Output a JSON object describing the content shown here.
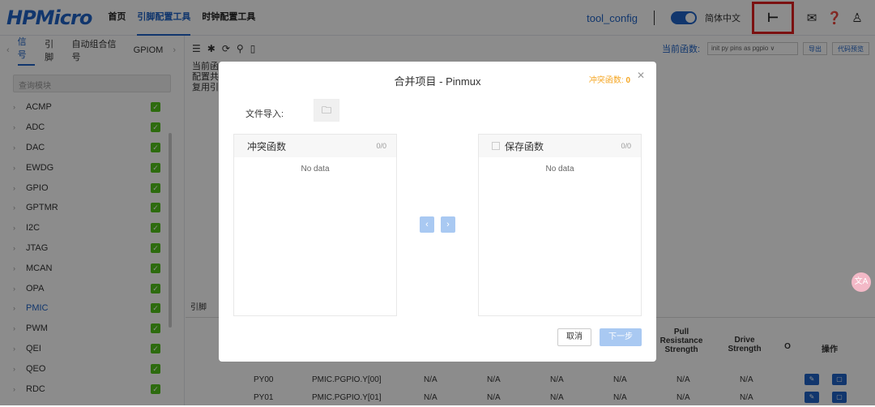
{
  "header": {
    "logo": "HPMicro",
    "nav": [
      "首页",
      "引脚配置工具",
      "时钟配置工具"
    ],
    "active_nav": 1,
    "project": "tool_config",
    "language": "简体中文"
  },
  "left": {
    "tabs": [
      "信号",
      "引脚",
      "自动组合信号",
      "GPIOM"
    ],
    "search_placeholder": "查询模块",
    "modules": [
      "ACMP",
      "ADC",
      "DAC",
      "EWDG",
      "GPIO",
      "GPTMR",
      "I2C",
      "JTAG",
      "MCAN",
      "OPA",
      "PMIC",
      "PWM",
      "QEI",
      "QEO",
      "RDC"
    ],
    "active_module": "PMIC"
  },
  "main": {
    "current_func_label": "当前函数:",
    "current_func_value": "init py pins as pgpio ∨",
    "export_label": "导出",
    "preview_label": "代码预览",
    "info_lines": [
      "当前函",
      "配置共",
      "复用引"
    ],
    "lower_tab": "引脚",
    "table_headers": {
      "pull": "Pull Resistance Strength",
      "drive": "Drive Strength",
      "op": "操作",
      "o": "O"
    },
    "rows": [
      {
        "pin": "PY00",
        "func": "PMIC.PGPIO.Y[00]",
        "v1": "N/A",
        "v2": "N/A",
        "v3": "N/A",
        "v4": "N/A",
        "v5": "N/A",
        "v6": "N/A"
      },
      {
        "pin": "PY01",
        "func": "PMIC.PGPIO.Y[01]",
        "v1": "N/A",
        "v2": "N/A",
        "v3": "N/A",
        "v4": "N/A",
        "v5": "N/A",
        "v6": "N/A"
      }
    ]
  },
  "dialog": {
    "title": "合并项目 - Pinmux",
    "conflict_label": "冲突函数:",
    "conflict_count": "0",
    "file_import_label": "文件导入:",
    "left_panel_title": "冲突函数",
    "left_panel_count": "0/0",
    "right_panel_title": "保存函数",
    "right_panel_count": "0/0",
    "no_data": "No data",
    "cancel_label": "取消",
    "next_label": "下一步"
  },
  "icons": {
    "merge": "branch-icon",
    "mail": "mail-icon",
    "help": "help-icon",
    "user": "user-icon",
    "folder": "folder-icon"
  },
  "colors": {
    "accent": "#1f63c6",
    "highlight": "#e02020",
    "warning": "#f5a623",
    "check": "#52c41a"
  }
}
